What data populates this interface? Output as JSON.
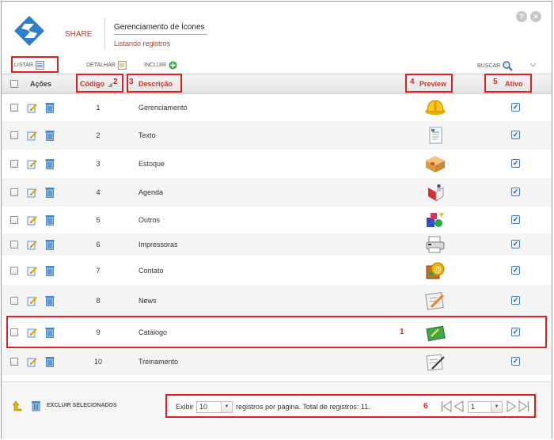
{
  "header": {
    "app_name": "SHARE",
    "title": "Gerenciamento de Ícones",
    "subtitle": "Listando registros",
    "help_label": "?",
    "close_label": "×"
  },
  "toolbar": {
    "listar": "LISTAR",
    "detalhar": "DETALHAR",
    "incluir": "INCLUIR",
    "buscar": "BUSCAR"
  },
  "columns": {
    "acoes": "Ações",
    "codigo": "Código",
    "descricao": "Descrição",
    "preview": "Preview",
    "ativo": "Ativo"
  },
  "rows": [
    {
      "code": "1",
      "desc": "Gerenciamento",
      "icon": "hard-hat-icon",
      "active": true
    },
    {
      "code": "2",
      "desc": "Texto",
      "icon": "text-document-icon",
      "active": true
    },
    {
      "code": "3",
      "desc": "Estoque",
      "icon": "box-icon",
      "active": true
    },
    {
      "code": "4",
      "desc": "Agenda",
      "icon": "agenda-book-icon",
      "active": true
    },
    {
      "code": "5",
      "desc": "Outros",
      "icon": "shapes-icon",
      "active": true
    },
    {
      "code": "6",
      "desc": "Impressoras",
      "icon": "printer-icon",
      "active": true
    },
    {
      "code": "7",
      "desc": "Contato",
      "icon": "contact-at-icon",
      "active": true
    },
    {
      "code": "8",
      "desc": "News",
      "icon": "news-pen-icon",
      "active": true
    },
    {
      "code": "9",
      "desc": "Catálogo",
      "icon": "catalog-icon",
      "active": true
    },
    {
      "code": "10",
      "desc": "Treinamento",
      "icon": "clipboard-pen-icon",
      "active": true
    }
  ],
  "footer": {
    "delete_selected": "EXCLUIR SELECIONADOS",
    "exibir": "Exibir",
    "per_page_value": "10",
    "per_page_text": "registros por página. Total de registros: 11.",
    "page_value": "1"
  },
  "annotations": [
    "1",
    "2",
    "3",
    "4",
    "5",
    "6"
  ],
  "colors": {
    "accent_red": "#e02020",
    "brand_orange": "#c0392b",
    "checkbox_blue": "#24568c"
  }
}
